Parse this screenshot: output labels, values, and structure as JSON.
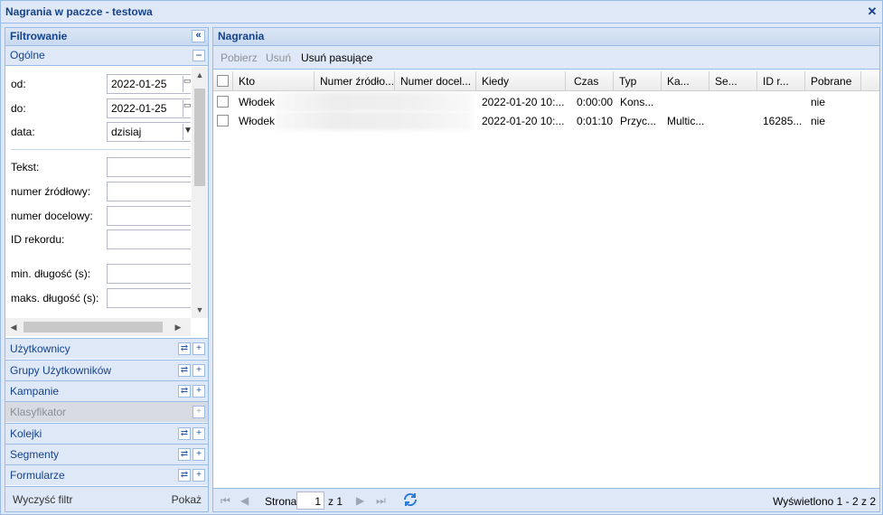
{
  "window": {
    "title": "Nagrania w paczce - testowa",
    "close": "✕"
  },
  "filter": {
    "title": "Filtrowanie",
    "collapse": "«",
    "section": "Ogólne",
    "section_toggle": "−",
    "fields": {
      "od_label": "od:",
      "od_value": "2022-01-25",
      "do_label": "do:",
      "do_value": "2022-01-25",
      "data_label": "data:",
      "data_value": "dzisiaj",
      "tekst_label": "Tekst:",
      "src_label": "numer źródłowy:",
      "dst_label": "numer docelowy:",
      "id_label": "ID rekordu:",
      "min_label": "min. długość (s):",
      "max_label": "maks. długość (s):"
    },
    "accordion": [
      {
        "label": "Użytkownicy"
      },
      {
        "label": "Grupy Użytkowników"
      },
      {
        "label": "Kampanie"
      },
      {
        "label": "Klasyfikator"
      },
      {
        "label": "Kolejki"
      },
      {
        "label": "Segmenty"
      },
      {
        "label": "Formularze"
      }
    ],
    "clear": "Wyczyść filtr",
    "show": "Pokaż"
  },
  "recordings": {
    "title": "Nagrania",
    "toolbar": {
      "download": "Pobierz",
      "delete": "Usuń",
      "delete_matching": "Usuń pasujące"
    },
    "columns": [
      "Kto",
      "Numer źródło...",
      "Numer docel...",
      "Kiedy",
      "Czas",
      "Typ",
      "Ka...",
      "Se...",
      "ID r...",
      "Pobrane"
    ],
    "rows": [
      {
        "kto": "Włodek",
        "kiedy": "2022-01-20 10:...",
        "czas": "0:00:00",
        "typ": "Kons...",
        "ka": "",
        "se": "",
        "id": "",
        "pobrane": "nie"
      },
      {
        "kto": "Włodek",
        "kiedy": "2022-01-20 10:...",
        "czas": "0:01:10",
        "typ": "Przyc...",
        "ka": "Multic...",
        "se": "",
        "id": "16285...",
        "pobrane": "nie"
      }
    ],
    "pager": {
      "page_label": "Strona",
      "page": "1",
      "of": "z 1",
      "displayed": "Wyświetlono 1 - 2 z 2"
    }
  },
  "colors": {
    "panel_header": "#15428b",
    "border": "#99bbe8",
    "bg": "#dfe8f6"
  }
}
